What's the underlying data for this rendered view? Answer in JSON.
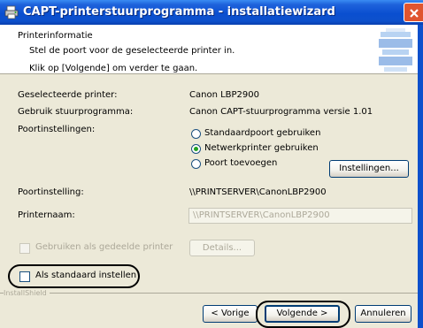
{
  "window": {
    "title": "CAPT-printerstuurprogramma - installatiewizard",
    "icon": "printer-setup-icon",
    "close_icon": "close-icon"
  },
  "header": {
    "title": "Printerinformatie",
    "subtitle": "Stel de poort voor de geselecteerde printer in.",
    "instruction": "Klik op [Volgende] om verder te gaan.",
    "graphic": "printer-stack-icon"
  },
  "info": {
    "selected_printer_label": "Geselecteerde printer:",
    "selected_printer_value": "Canon LBP2900",
    "driver_label": "Gebruik stuurprogramma:",
    "driver_value": "Canon CAPT-stuurprogramma versie 1.01",
    "port_settings_label": "Poortinstellingen:",
    "port_setting_label": "Poortinstelling:",
    "port_setting_value": "\\\\PRINTSERVER\\CanonLBP2900",
    "printer_name_label": "Printernaam:",
    "printer_name_value": "\\\\PRINTSERVER\\CanonLBP2900"
  },
  "port_options": [
    {
      "label": "Standaardpoort gebruiken",
      "selected": false
    },
    {
      "label": "Netwerkprinter gebruiken",
      "selected": true
    },
    {
      "label": "Poort toevoegen",
      "selected": false
    }
  ],
  "buttons": {
    "settings": "Instellingen...",
    "details": "Details...",
    "back": "< Vorige",
    "next": "Volgende >",
    "cancel": "Annuleren"
  },
  "checkboxes": {
    "shared": {
      "label": "Gebruiken als gedeelde printer",
      "checked": false,
      "enabled": false
    },
    "default": {
      "label": "Als standaard instellen",
      "checked": false,
      "enabled": true
    }
  },
  "footer": {
    "brand": "InstallShield"
  },
  "colors": {
    "title_bar": "#0a4fd0",
    "dialog_bg": "#ece9d8",
    "radio_dot": "#21a121"
  }
}
